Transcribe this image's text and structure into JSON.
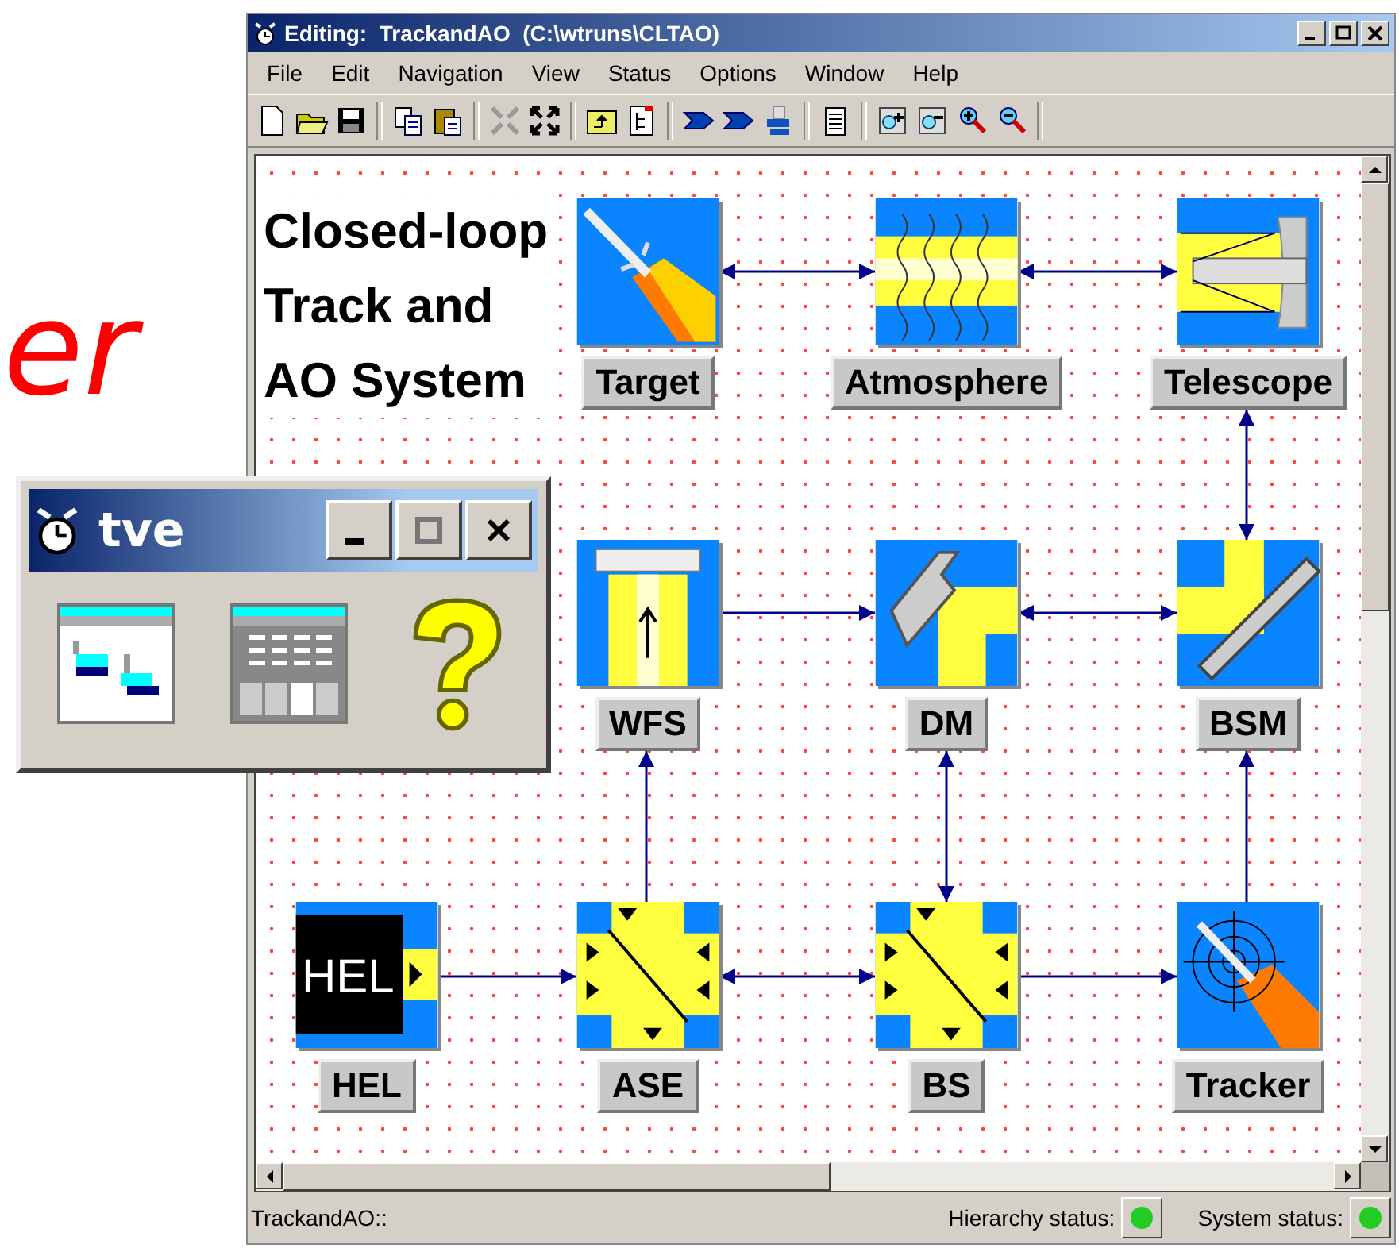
{
  "background_text": "er",
  "main_window": {
    "title": "Editing:  TrackandAO  (C:\\wtruns\\CLTAO)",
    "menu": [
      "File",
      "Edit",
      "Navigation",
      "View",
      "Status",
      "Options",
      "Window",
      "Help"
    ],
    "diagram": {
      "title_lines": [
        "Closed-loop",
        "Track and",
        "AO System"
      ],
      "nodes": [
        {
          "label": "Target",
          "kind": "target"
        },
        {
          "label": "Atmosphere",
          "kind": "atmosphere"
        },
        {
          "label": "Telescope",
          "kind": "telescope"
        },
        {
          "label": "WFS",
          "kind": "wfs"
        },
        {
          "label": "DM",
          "kind": "dm"
        },
        {
          "label": "BSM",
          "kind": "bsm"
        },
        {
          "label": "HEL",
          "kind": "hel",
          "icon_text": "HEL"
        },
        {
          "label": "ASE",
          "kind": "splitter"
        },
        {
          "label": "BS",
          "kind": "splitter"
        },
        {
          "label": "Tracker",
          "kind": "tracker"
        }
      ]
    },
    "status_bar": {
      "path": "TrackandAO::",
      "indicators": [
        {
          "label": "Hierarchy status:",
          "color": "#22cc22"
        },
        {
          "label": "System status:",
          "color": "#22cc22"
        }
      ]
    }
  },
  "tve_window": {
    "title": "tve"
  }
}
